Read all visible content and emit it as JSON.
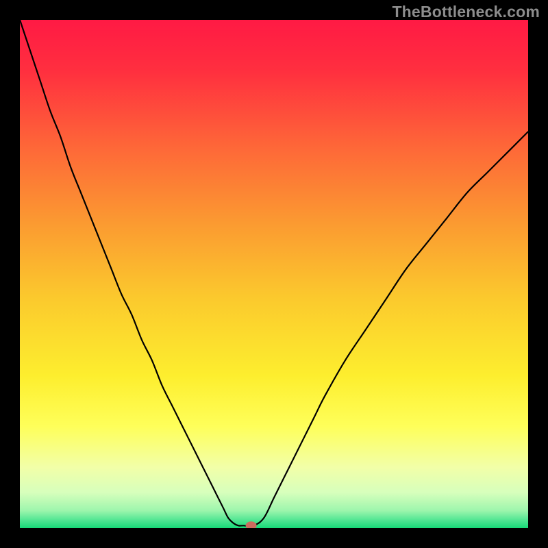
{
  "watermark": "TheBottleneck.com",
  "colors": {
    "black": "#000000",
    "curve": "#000000",
    "marker": "#cc6a5e"
  },
  "chart_data": {
    "type": "line",
    "title": "",
    "xlabel": "",
    "ylabel": "",
    "xlim": [
      0,
      100
    ],
    "ylim": [
      0,
      100
    ],
    "x": [
      0,
      2,
      4,
      6,
      8,
      10,
      12,
      14,
      16,
      18,
      20,
      22,
      24,
      26,
      28,
      30,
      32,
      34,
      36,
      38,
      40,
      41,
      42,
      43,
      44,
      46,
      48,
      50,
      52,
      54,
      56,
      58,
      60,
      64,
      68,
      72,
      76,
      80,
      84,
      88,
      92,
      96,
      100
    ],
    "y": [
      100,
      94,
      88,
      82,
      77,
      71,
      66,
      61,
      56,
      51,
      46,
      42,
      37,
      33,
      28,
      24,
      20,
      16,
      12,
      8,
      4,
      2,
      1,
      0.5,
      0.5,
      0.5,
      2,
      6,
      10,
      14,
      18,
      22,
      26,
      33,
      39,
      45,
      51,
      56,
      61,
      66,
      70,
      74,
      78
    ],
    "flat_range_x": [
      42,
      46
    ],
    "flat_y": 0.5,
    "marker": {
      "x": 45.5,
      "y": 0.5
    },
    "gradient_stops": [
      {
        "pos": 0.0,
        "color": "#ff1a44"
      },
      {
        "pos": 0.1,
        "color": "#ff2f3f"
      },
      {
        "pos": 0.25,
        "color": "#fe6738"
      },
      {
        "pos": 0.4,
        "color": "#fb9a31"
      },
      {
        "pos": 0.55,
        "color": "#fbca2d"
      },
      {
        "pos": 0.7,
        "color": "#fdee2e"
      },
      {
        "pos": 0.8,
        "color": "#feff5a"
      },
      {
        "pos": 0.88,
        "color": "#f2ffa8"
      },
      {
        "pos": 0.93,
        "color": "#d7ffbc"
      },
      {
        "pos": 0.965,
        "color": "#9ef6ad"
      },
      {
        "pos": 0.985,
        "color": "#4ee592"
      },
      {
        "pos": 1.0,
        "color": "#17d977"
      }
    ]
  }
}
